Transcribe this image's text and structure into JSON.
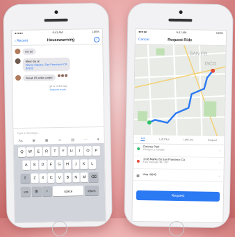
{
  "left_phone": {
    "status": {
      "carrier": "●●●●● ",
      "time": "9:41 AM",
      "battery": "100%"
    },
    "nav": {
      "back": "‹ Recent",
      "title": "Housewarming"
    },
    "messages": [
      {
        "text": "I'm in!"
      },
      {
        "text": "Meet me at",
        "address": "Alamo Square, San Francisco CA 94102"
      },
      {
        "text": "Great, I'll order a ride!"
      }
    ],
    "ride_status": {
      "line1": "Lyft is on the way",
      "link": "Request to join"
    },
    "compose_placeholder": "Type a message...",
    "keyboard": {
      "row1": [
        "Q",
        "W",
        "E",
        "R",
        "T",
        "Y",
        "U",
        "I",
        "O",
        "P"
      ],
      "row2": [
        "A",
        "S",
        "D",
        "F",
        "G",
        "H",
        "J",
        "K",
        "L"
      ],
      "row3": [
        "Z",
        "X",
        "C",
        "V",
        "B",
        "N",
        "M"
      ],
      "space": "space",
      "return": "return",
      "num": "123"
    }
  },
  "right_phone": {
    "status": {
      "carrier": "●●●●● ",
      "time": "9:41 AM",
      "battery": "100%"
    },
    "nav": {
      "cancel": "Cancel",
      "title": "Request Ride"
    },
    "tabs": [
      "Lyft",
      "Lyft Plus",
      "Lyft Line",
      "Carpool"
    ],
    "pickup": {
      "name": "Dolores Park",
      "sub": "Pickup in 2 minutes"
    },
    "dropoff": {
      "name": "1138 Market St San Francisco CA",
      "sub": "Fare Estimate: $8 - $12"
    },
    "payment": {
      "label": "Visa •0648"
    },
    "request_label": "Request",
    "map_labels": {
      "area": "SAN FR",
      "area2": "ISCO"
    }
  },
  "colors": {
    "accent": "#2b79f3",
    "route": "#2b79f3"
  }
}
